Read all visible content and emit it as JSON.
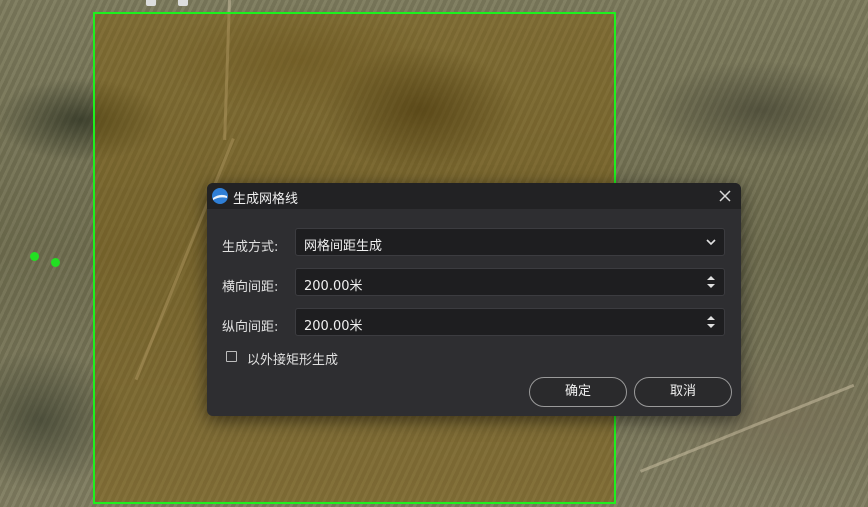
{
  "dialog": {
    "title": "生成网格线",
    "method_label": "生成方式:",
    "method_value": "网格间距生成",
    "h_spacing_label": "横向间距:",
    "h_spacing_value": "200.00米",
    "v_spacing_label": "纵向间距:",
    "v_spacing_value": "200.00米",
    "bbox_checkbox_label": "以外接矩形生成",
    "bbox_checked": false,
    "ok_label": "确定",
    "cancel_label": "取消"
  },
  "icons": {
    "logo": "app-logo-icon",
    "close": "close-icon",
    "dropdown": "chevron-down-icon",
    "spinner": "spinner-arrows-icon"
  },
  "colors": {
    "selection_border": "#1ef01e",
    "selection_fill": "#825a00",
    "dialog_bg": "#2e2e31",
    "title_bg": "#222224",
    "field_bg": "#1e1e20",
    "logo": "#2f7fd6"
  }
}
